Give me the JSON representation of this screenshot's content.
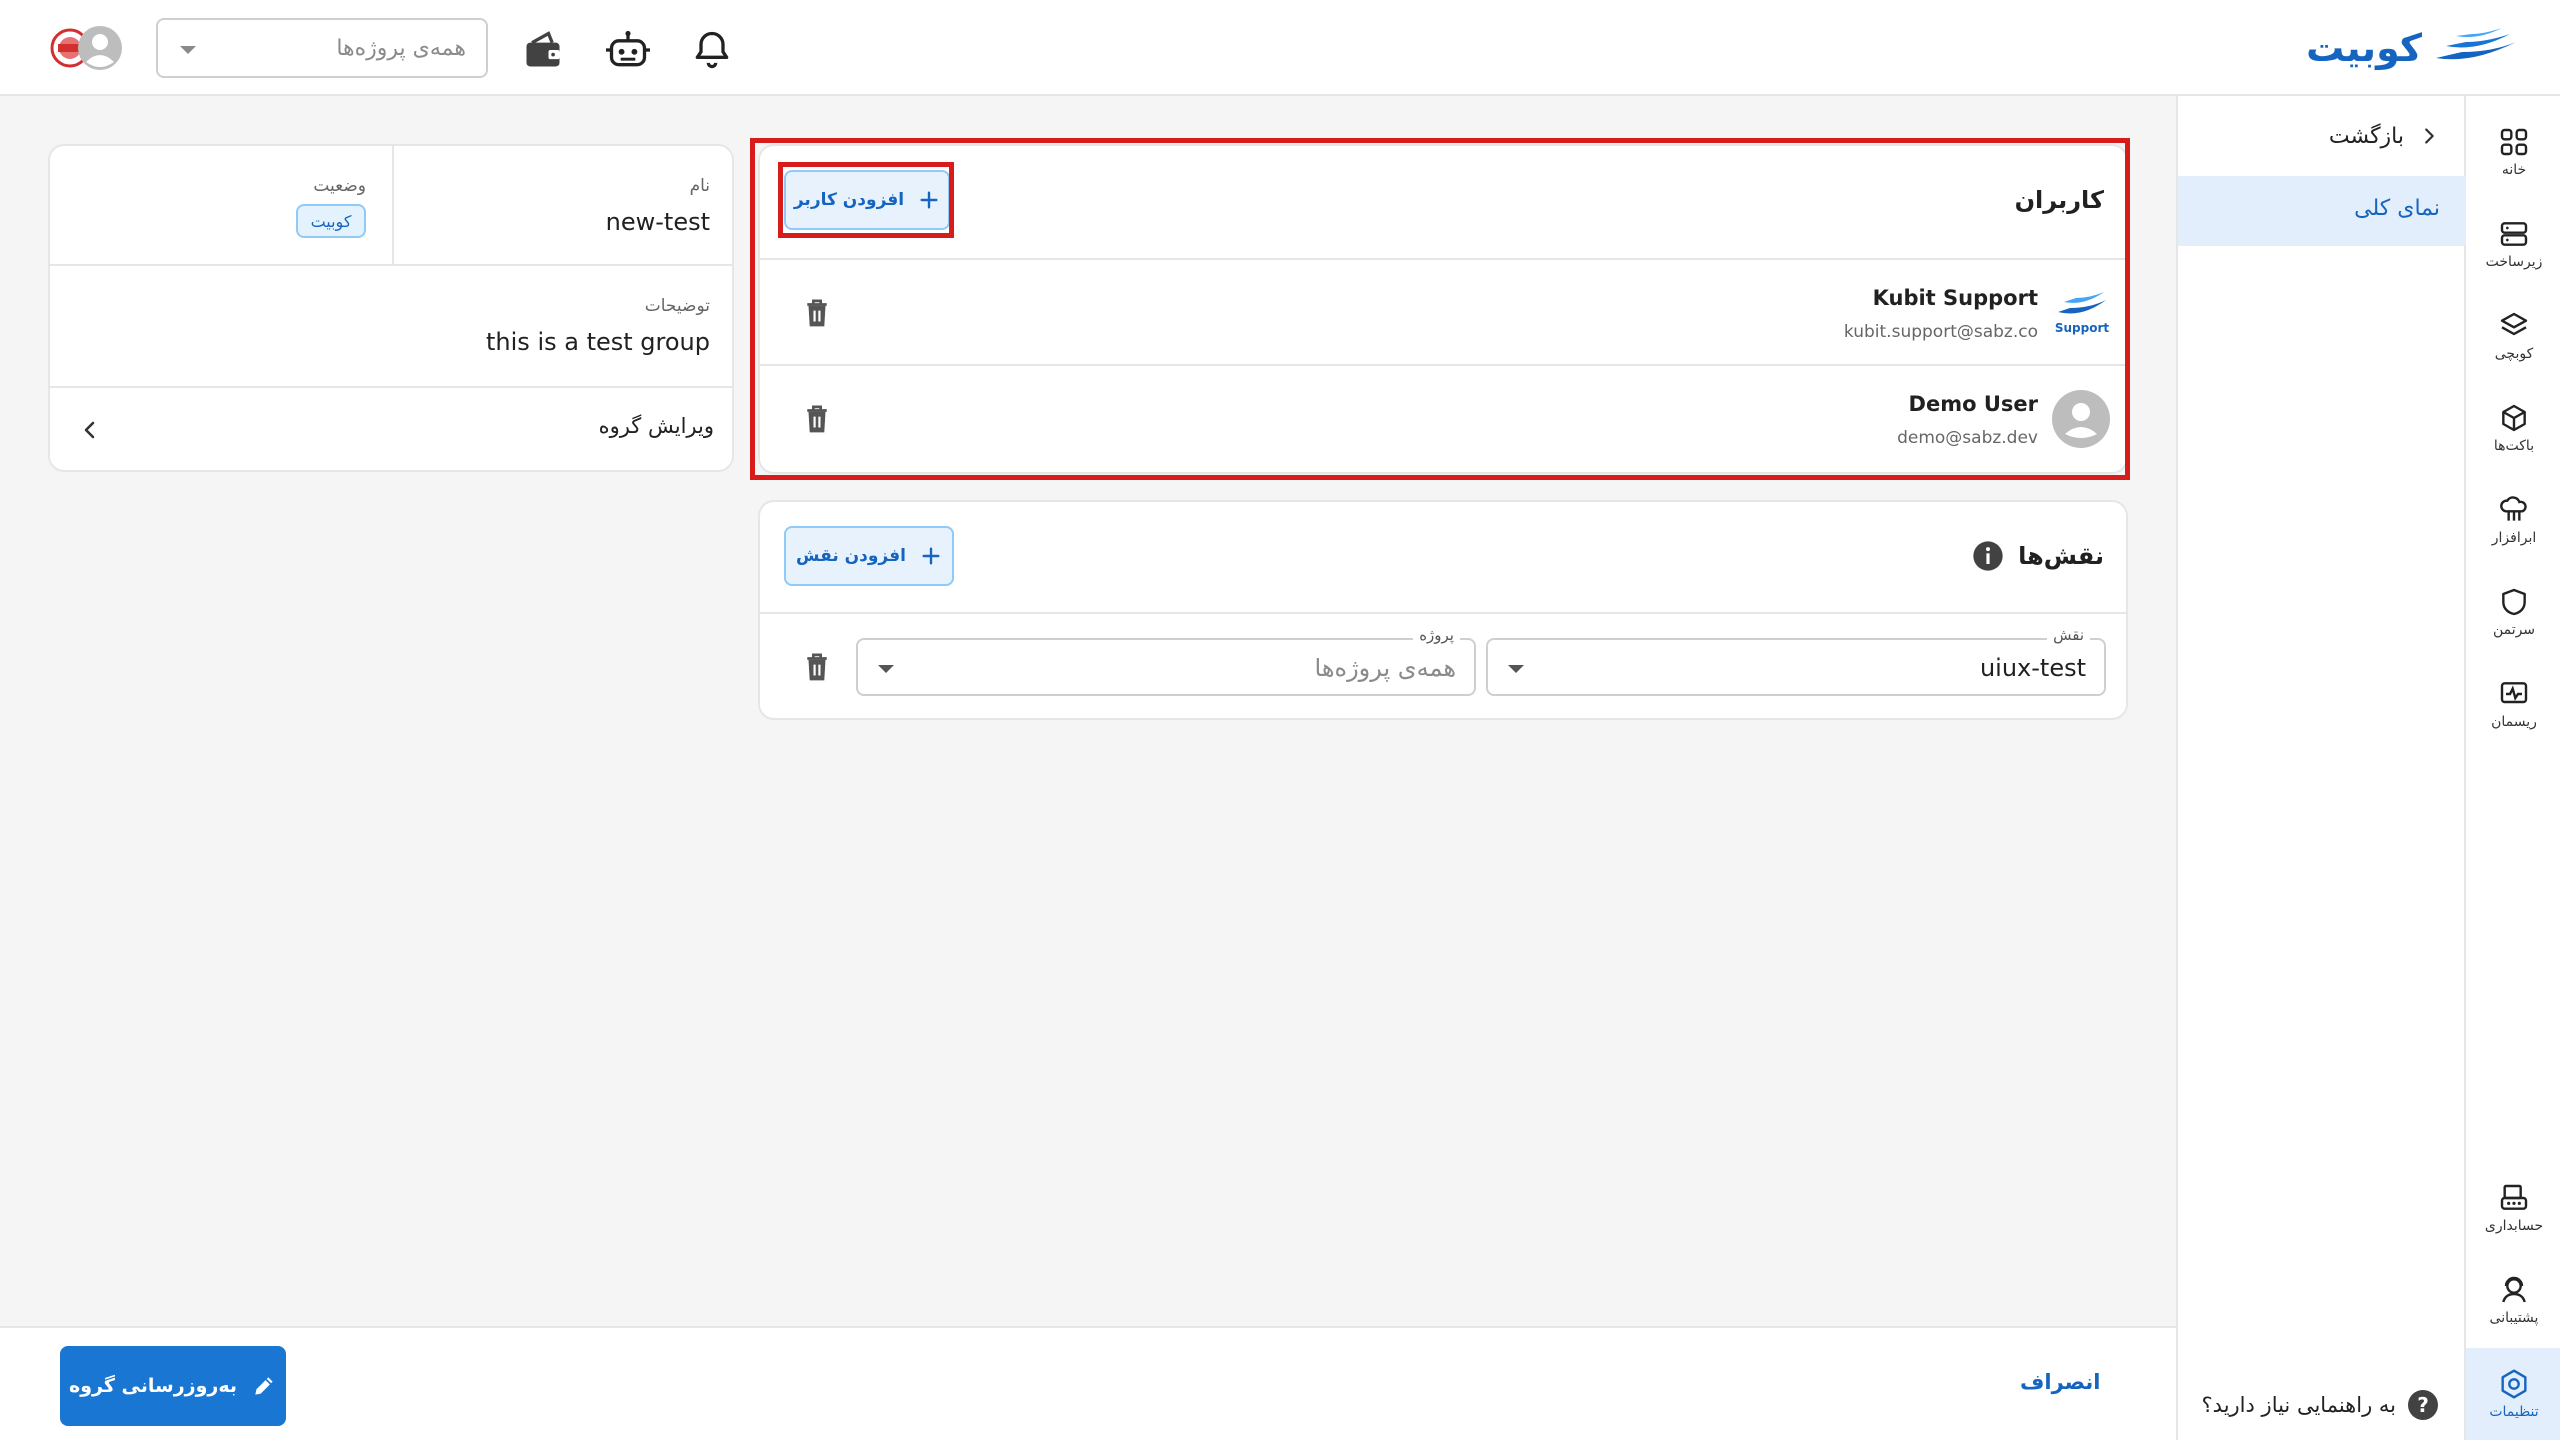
{
  "app": {
    "brand": "کوبیت",
    "brand_color": "#1565c0"
  },
  "topbar": {
    "project_select_placeholder": "همه‌ی پروژه‌ها",
    "icons": [
      "bell-icon",
      "robot-icon",
      "wallet-icon",
      "user-avatar-icon"
    ]
  },
  "sidebar": {
    "items": [
      {
        "label": "خانه",
        "icon": "grid-icon"
      },
      {
        "label": "زیرساخت",
        "icon": "server-icon"
      },
      {
        "label": "کوبچی",
        "icon": "layers-icon"
      },
      {
        "label": "باکت‌ها",
        "icon": "box-icon"
      },
      {
        "label": "ابرافزار",
        "icon": "cloud-app-icon"
      },
      {
        "label": "سرتمن",
        "icon": "shield-icon"
      },
      {
        "label": "ریسمان",
        "icon": "monitor-wave-icon"
      },
      {
        "label": "حسابداری",
        "icon": "accounting-icon"
      },
      {
        "label": "پشتیبانی",
        "icon": "support-icon"
      },
      {
        "label": "تنظیمات",
        "icon": "settings-icon"
      }
    ]
  },
  "subnav": {
    "back_label": "بازگشت",
    "overview_label": "نمای کلی",
    "help_label": "به راهنمایی نیاز دارید؟"
  },
  "info_card": {
    "name_label": "نام",
    "name_value": "new-test",
    "status_label": "وضعیت",
    "status_value": "کوبیت",
    "description_label": "توضیحات",
    "description_value": "this is a test group",
    "edit_label": "ویرایش گروه"
  },
  "users_card": {
    "title": "کاربران",
    "add_button_label": "افزودن کاربر",
    "users": [
      {
        "name": "Kubit Support",
        "email": "kubit.support@sabz.co",
        "avatar_text": "Support"
      },
      {
        "name": "Demo User",
        "email": "demo@sabz.dev"
      }
    ]
  },
  "roles_card": {
    "title": "نقش‌ها",
    "add_button_label": "افزودن نقش",
    "roles": [
      {
        "role_label": "نقش",
        "role_value": "uiux-test",
        "project_label": "پروژه",
        "project_value": "همه‌ی پروژه‌ها"
      }
    ]
  },
  "bottombar": {
    "update_button_label": "به‌روزرسانی گروه",
    "cancel_button_label": "انصراف"
  },
  "colors": {
    "primary": "#1976d2",
    "highlight_box": "#d81b1b",
    "selected_bg": "#e3eefc"
  }
}
